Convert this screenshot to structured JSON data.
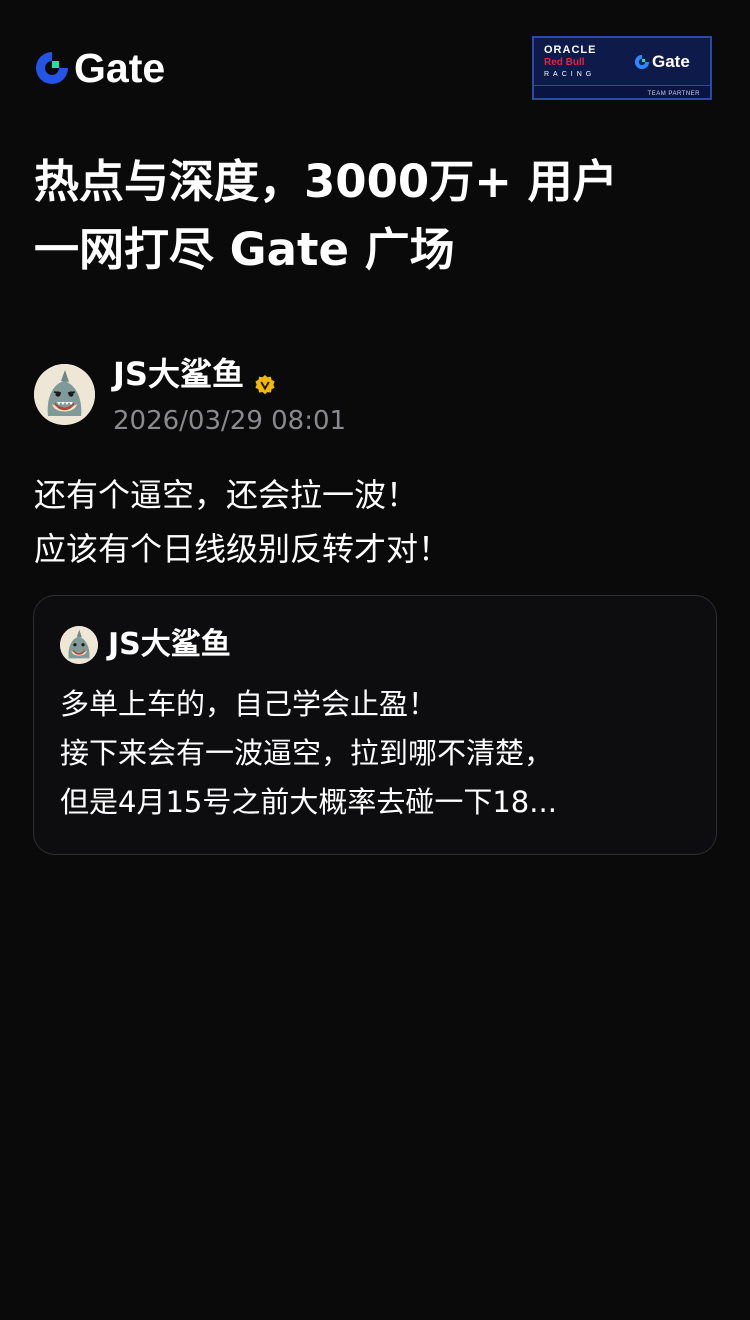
{
  "header": {
    "brand": "Gate",
    "partner_badge": {
      "line1": "ORACLE",
      "line2": "Red Bull",
      "line3": "RACING",
      "brand": "Gate",
      "footer": "TEAM PARTNER"
    }
  },
  "headline": {
    "line1": "热点与深度，3000万+ 用户",
    "line2": "一网打尽 Gate 广场"
  },
  "post": {
    "author": "JS大鲨鱼",
    "verified_icon": "verified-badge-icon",
    "timestamp": "2026/03/29 08:01",
    "body": [
      "还有个逼空，还会拉一波！",
      "应该有个日线级别反转才对！"
    ]
  },
  "quoted_post": {
    "author": "JS大鲨鱼",
    "body": [
      "多单上车的，自己学会止盈！",
      "接下来会有一波逼空，拉到哪不清楚，",
      "但是4月15号之前大概率去碰一下18..."
    ]
  },
  "colors": {
    "background": "#0a0a0a",
    "brand_blue": "#2354e6",
    "brand_green": "#17e6a1",
    "verified_gold": "#f0b90b",
    "muted_text": "#8a8a8e",
    "card_border": "#2e2e32"
  }
}
